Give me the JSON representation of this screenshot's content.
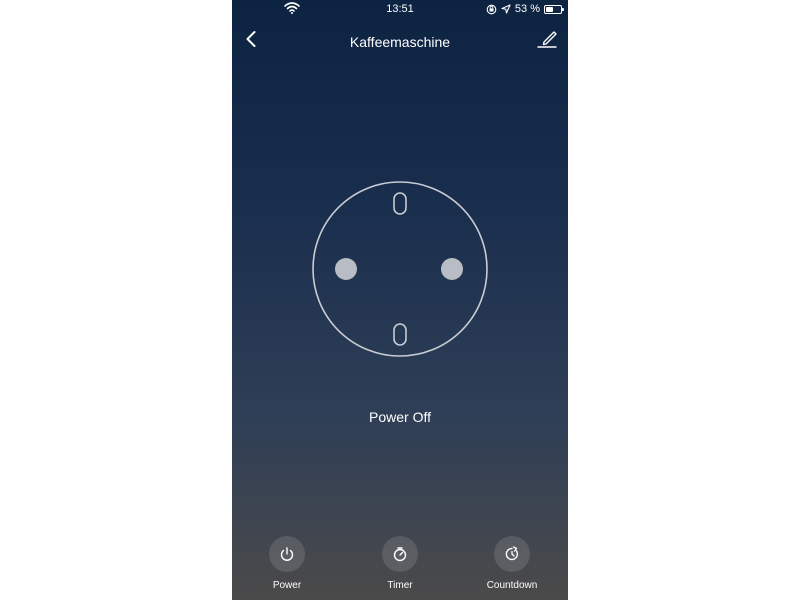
{
  "status_bar": {
    "time": "13:51",
    "battery_text": "53 %",
    "battery_level": 0.53,
    "icons": [
      "wifi-icon",
      "orientation-lock-icon",
      "location-icon",
      "battery-icon"
    ]
  },
  "nav": {
    "title": "Kaffeemaschine",
    "back_icon": "chevron-left-icon",
    "edit_icon": "edit-pencil-icon"
  },
  "device": {
    "status": "Power Off",
    "icon": "socket-outlet-icon"
  },
  "actions": [
    {
      "label": "Power",
      "icon": "power-icon"
    },
    {
      "label": "Timer",
      "icon": "timer-icon"
    },
    {
      "label": "Countdown",
      "icon": "countdown-icon"
    }
  ],
  "colors": {
    "gradient_top": "#0d2342",
    "gradient_bottom": "#4b4a4a",
    "socket_pin": "#b8bcc4",
    "text": "#ffffff"
  }
}
